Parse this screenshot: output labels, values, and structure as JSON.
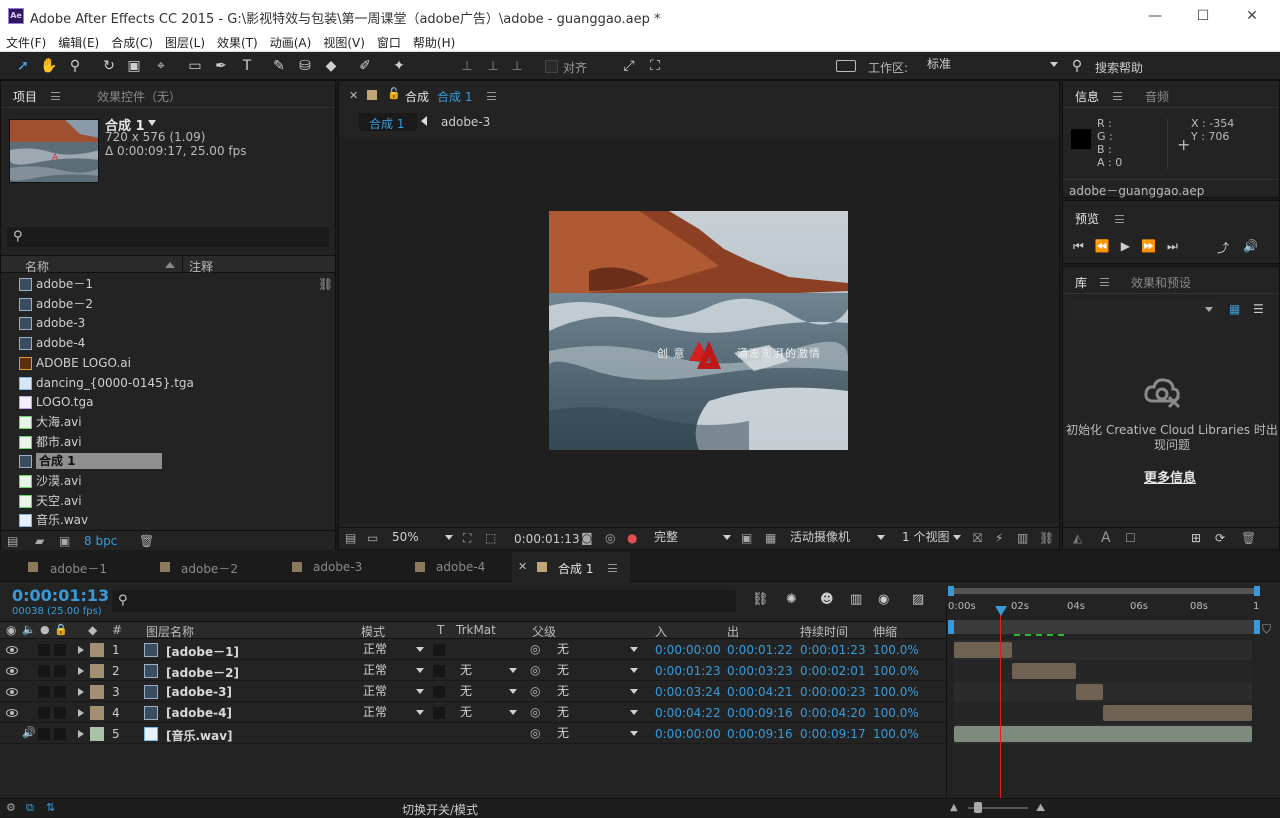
{
  "window": {
    "title": "Adobe After Effects CC 2015 - G:\\影视特效与包装\\第一周课堂（adobe广告）\\adobe - guanggao.aep *",
    "logo": "Ae",
    "minimize": "—",
    "maximize": "☐",
    "close": "✕"
  },
  "menu": [
    "文件(F)",
    "编辑(E)",
    "合成(C)",
    "图层(L)",
    "效果(T)",
    "动画(A)",
    "视图(V)",
    "窗口",
    "帮助(H)"
  ],
  "toolbar": {
    "snap_label": "对齐",
    "workspace_label": "工作区:",
    "workspace_value": "标准",
    "search_help": "搜索帮助"
  },
  "project": {
    "tab_active": "项目",
    "tab_inactive": "效果控件（无）",
    "comp_name": "合成 1",
    "comp_size": "720 x 576 (1.09)",
    "comp_duration": "Δ 0:00:09:17, 25.00 fps",
    "col_name": "名称",
    "col_comment": "注释",
    "items": [
      {
        "name": "adobe－1",
        "type": "comp"
      },
      {
        "name": "adobe－2",
        "type": "comp"
      },
      {
        "name": "adobe-3",
        "type": "comp"
      },
      {
        "name": "adobe-4",
        "type": "comp"
      },
      {
        "name": "ADOBE LOGO.ai",
        "type": "ai"
      },
      {
        "name": "dancing_{0000-0145}.tga",
        "type": "tga"
      },
      {
        "name": "LOGO.tga",
        "type": "logo"
      },
      {
        "name": "大海.avi",
        "type": "avi"
      },
      {
        "name": "都市.avi",
        "type": "avi"
      },
      {
        "name": "合成 1",
        "type": "comp",
        "selected": true
      },
      {
        "name": "沙漠.avi",
        "type": "avi"
      },
      {
        "name": "天空.avi",
        "type": "avi"
      },
      {
        "name": "音乐.wav",
        "type": "wav"
      }
    ],
    "bpc": "8 bpc"
  },
  "composition": {
    "tab_label": "合成",
    "tab_name": "合成 1",
    "flow_active": "合成 1",
    "flow_next": "adobe-3",
    "overlay_text_left": "创 意",
    "overlay_text_right": "涌澎澎湃的激情",
    "zoom": "50%",
    "timecode": "0:00:01:13",
    "quality": "完整",
    "camera": "活动摄像机",
    "views": "1 个视图"
  },
  "info": {
    "tab_active": "信息",
    "tab_inactive": "音频",
    "r": "R :",
    "g": "G :",
    "b": "B :",
    "a": "A : 0",
    "x": "X : -354",
    "y": "Y : 706",
    "file": "adobe－guanggao.aep"
  },
  "preview": {
    "tab": "预览"
  },
  "library": {
    "tab_active": "库",
    "tab_inactive": "效果和预设",
    "message": "初始化 Creative Cloud Libraries 时出现问题",
    "more_info": "更多信息"
  },
  "timeline": {
    "tabs": [
      "adobe－1",
      "adobe－2",
      "adobe-3",
      "adobe-4",
      "合成 1"
    ],
    "current_time": "0:00:01:13",
    "frame_info": "00038 (25.00 fps)",
    "col_hash": "#",
    "col_layer_name": "图层名称",
    "col_mode": "模式",
    "col_t": "T",
    "col_trkmat": "TrkMat",
    "col_parent": "父级",
    "col_in": "入",
    "col_out": "出",
    "col_duration": "持续时间",
    "col_stretch": "伸缩",
    "ruler": [
      "0:00s",
      "02s",
      "04s",
      "06s",
      "08s",
      "1"
    ],
    "footer_label": "切换开关/模式",
    "layers": [
      {
        "num": "1",
        "name": "[adobe－1]",
        "mode": "正常",
        "trkmat": "",
        "parent": "无",
        "in": "0:00:00:00",
        "out": "0:00:01:22",
        "duration": "0:00:01:23",
        "stretch": "100.0%",
        "color": "#a28f74",
        "start": 0.0,
        "end": 0.196
      },
      {
        "num": "2",
        "name": "[adobe－2]",
        "mode": "正常",
        "trkmat": "无",
        "parent": "无",
        "in": "0:00:01:23",
        "out": "0:00:03:23",
        "duration": "0:00:02:01",
        "stretch": "100.0%",
        "color": "#a28f74",
        "start": 0.196,
        "end": 0.41
      },
      {
        "num": "3",
        "name": "[adobe-3]",
        "mode": "正常",
        "trkmat": "无",
        "parent": "无",
        "in": "0:00:03:24",
        "out": "0:00:04:21",
        "duration": "0:00:00:23",
        "stretch": "100.0%",
        "color": "#a28f74",
        "start": 0.41,
        "end": 0.5
      },
      {
        "num": "4",
        "name": "[adobe-4]",
        "mode": "正常",
        "trkmat": "无",
        "parent": "无",
        "in": "0:00:04:22",
        "out": "0:00:09:16",
        "duration": "0:00:04:20",
        "stretch": "100.0%",
        "color": "#a28f74",
        "start": 0.5,
        "end": 1.0
      },
      {
        "num": "5",
        "name": "[音乐.wav]",
        "mode": "",
        "trkmat": "",
        "parent": "无",
        "in": "0:00:00:00",
        "out": "0:00:09:16",
        "duration": "0:00:09:17",
        "stretch": "100.0%",
        "color": "#a9c2a8",
        "start": 0.0,
        "end": 1.0
      }
    ]
  }
}
